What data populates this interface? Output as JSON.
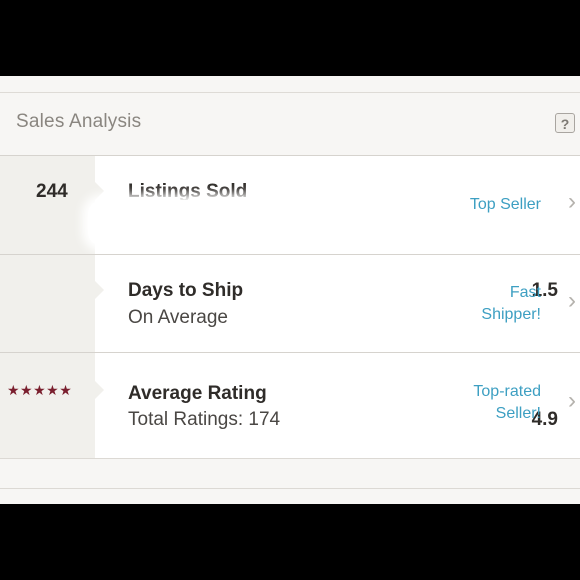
{
  "header": {
    "title": "Sales Analysis",
    "help_label": "?"
  },
  "rows": [
    {
      "value": "244",
      "title": "Listings Sold",
      "subtitle": "",
      "badge": [
        "Top Seller"
      ]
    },
    {
      "value": "1.5",
      "title": "Days to Ship",
      "subtitle": "On Average",
      "badge": [
        "Fast",
        "Shipper!"
      ]
    },
    {
      "value": "4.9",
      "stars": "★★★★★",
      "star_rating": 5,
      "title": "Average Rating",
      "subtitle": "Total Ratings: 174",
      "badge": [
        "Top-rated",
        "Seller!"
      ]
    }
  ],
  "icons": {
    "chevron": "chevron-right-icon",
    "star": "star-icon"
  },
  "colors": {
    "background": "#f7f6f4",
    "accent_link": "#3d9fc2",
    "star": "#7a1f2e",
    "text": "#2f2c29"
  }
}
